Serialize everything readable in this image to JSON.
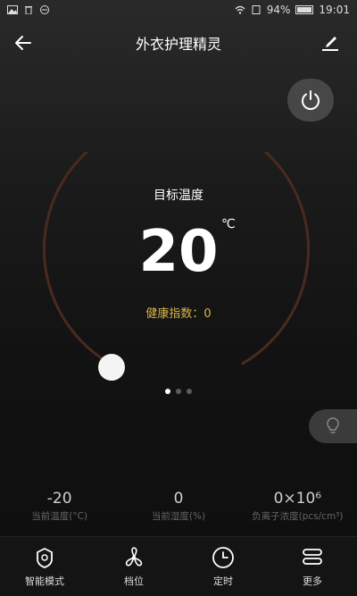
{
  "status_bar": {
    "battery": "94%",
    "time": "19:01"
  },
  "header": {
    "title": "外衣护理精灵"
  },
  "dial": {
    "target_label": "目标温度",
    "temperature": "20",
    "unit": "℃",
    "health_index": "健康指数：0"
  },
  "pager": {
    "pages": 3,
    "active": 0
  },
  "stats": [
    {
      "value": "-20",
      "label": "当前温度(°C)"
    },
    {
      "value": "0",
      "label": "当前湿度(%)"
    },
    {
      "value": "0×10⁶",
      "label": "负离子浓度(pcs/cm³)"
    }
  ],
  "nav": [
    {
      "label": "智能模式",
      "icon": "smart-mode-icon"
    },
    {
      "label": "档位",
      "icon": "fan-icon"
    },
    {
      "label": "定时",
      "icon": "clock-icon"
    },
    {
      "label": "更多",
      "icon": "more-icon"
    }
  ],
  "colors": {
    "accent": "#d8b44a",
    "dial_arc": "#4a2a1f",
    "background": "#141414"
  }
}
